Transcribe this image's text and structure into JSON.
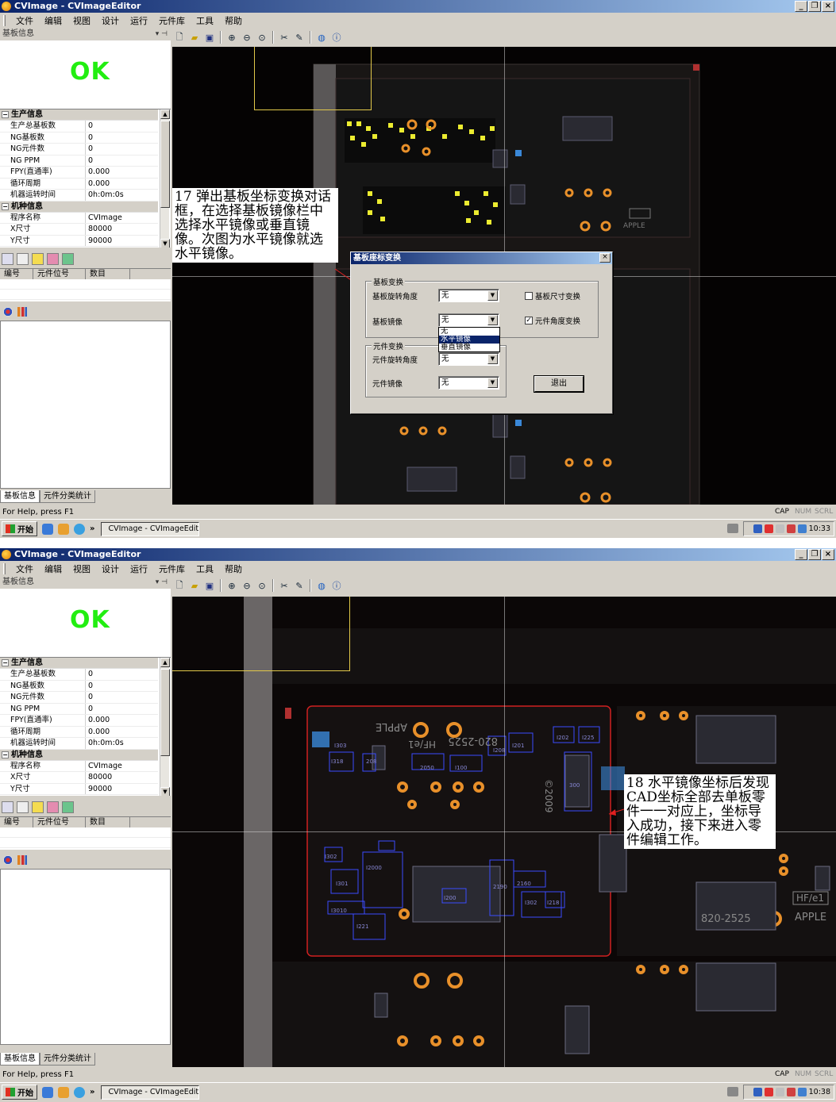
{
  "shots": [
    {
      "window_title": "CVImage - CVImageEditor",
      "menu": [
        "文件",
        "编辑",
        "视图",
        "设计",
        "运行",
        "元件库",
        "工具",
        "帮助"
      ],
      "panel_title": "基板信息",
      "ok_text": "OK",
      "prop_categories": {
        "production": "生产信息",
        "model": "机种信息"
      },
      "production_rows": [
        {
          "k": "生产总基板数",
          "v": "0"
        },
        {
          "k": "NG基板数",
          "v": "0"
        },
        {
          "k": "NG元件数",
          "v": "0"
        },
        {
          "k": "NG PPM",
          "v": "0"
        },
        {
          "k": "FPY(直通率)",
          "v": "0.000"
        },
        {
          "k": "循环周期",
          "v": "0.000"
        },
        {
          "k": "机器运转时间",
          "v": "0h:0m:0s"
        }
      ],
      "model_rows": [
        {
          "k": "程序名称",
          "v": "CVImage"
        },
        {
          "k": "X尺寸",
          "v": "80000"
        },
        {
          "k": "Y尺寸",
          "v": "90000"
        }
      ],
      "list_headers": [
        "编号",
        "元件位号",
        "数目"
      ],
      "bottom_tabs": [
        "基板信息",
        "元件分类统计"
      ],
      "status_text": "For Help, press F1",
      "status_indicators": [
        "CAP",
        "NUM",
        "SCRL"
      ],
      "start_label": "开始",
      "task_label": "CVImage - CVImageEditor",
      "clock": "10:33",
      "annotation": "17 弹出基板坐标变换对话框，在选择基板镜像栏中选择水平镜像或垂直镜像。次图为水平镜像就选水平镜像。",
      "dialog": {
        "title": "基板座标变换",
        "group_board": "基板变换",
        "board_rotation_label": "基板旋转角度",
        "board_rotation_value": "无",
        "board_size_check": "基板尺寸变换",
        "board_mirror_label": "基板镜像",
        "board_mirror_value": "无",
        "part_angle_check": "元件角度变换",
        "mirror_options": [
          "无",
          "水平镜像",
          "垂直镜像"
        ],
        "group_part": "元件变换",
        "part_rotation_label": "元件旋转角度",
        "part_rotation_value": "无",
        "part_mirror_label": "元件镜像",
        "part_mirror_value": "无",
        "exit_button": "退出"
      }
    },
    {
      "window_title": "CVImage - CVImageEditor",
      "menu": [
        "文件",
        "编辑",
        "视图",
        "设计",
        "运行",
        "元件库",
        "工具",
        "帮助"
      ],
      "panel_title": "基板信息",
      "ok_text": "OK",
      "prop_categories": {
        "production": "生产信息",
        "model": "机种信息"
      },
      "production_rows": [
        {
          "k": "生产总基板数",
          "v": "0"
        },
        {
          "k": "NG基板数",
          "v": "0"
        },
        {
          "k": "NG元件数",
          "v": "0"
        },
        {
          "k": "NG PPM",
          "v": "0"
        },
        {
          "k": "FPY(直通率)",
          "v": "0.000"
        },
        {
          "k": "循环周期",
          "v": "0.000"
        },
        {
          "k": "机器运转时间",
          "v": "0h:0m:0s"
        }
      ],
      "model_rows": [
        {
          "k": "程序名称",
          "v": "CVImage"
        },
        {
          "k": "X尺寸",
          "v": "80000"
        },
        {
          "k": "Y尺寸",
          "v": "90000"
        }
      ],
      "list_headers": [
        "编号",
        "元件位号",
        "数目"
      ],
      "bottom_tabs": [
        "基板信息",
        "元件分类统计"
      ],
      "status_text": "For Help, press F1",
      "status_indicators": [
        "CAP",
        "NUM",
        "SCRL"
      ],
      "start_label": "开始",
      "task_label": "CVImage - CVImageEditor",
      "clock": "10:38",
      "annotation": "18 水平镜像坐标后发现CAD坐标全部去单板零件一一对应上，坐标导入成功，接下来进入零件编辑工作。",
      "pcb_labels": [
        "APPLE",
        "820-2525",
        "HF/e1",
        "©2009"
      ]
    }
  ],
  "colors": {
    "ok_green": "#22ee11",
    "title_blue": "#0a246a",
    "cad_box_blue": "#3a4cff",
    "pad_orange": "#e8902a",
    "pcb_outline_red": "#d02020"
  }
}
